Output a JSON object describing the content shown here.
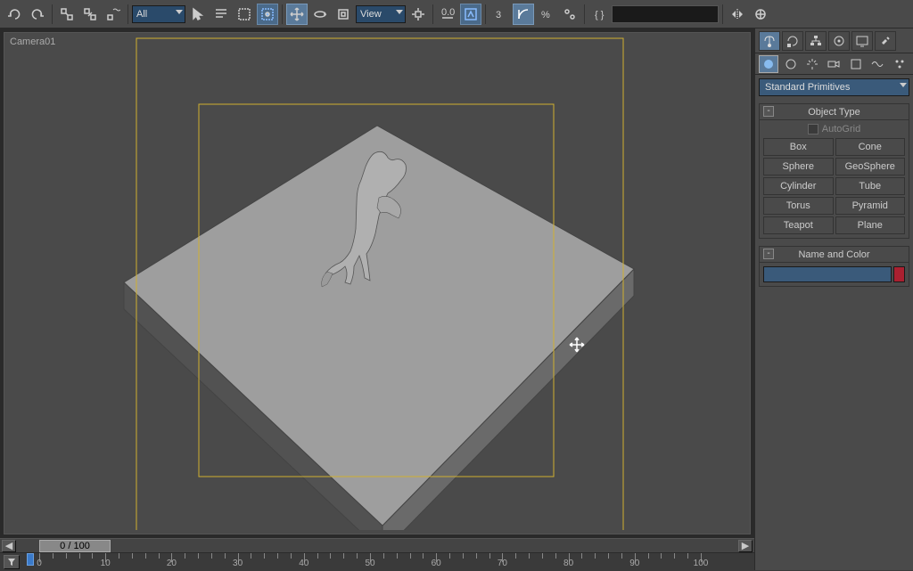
{
  "toolbar": {
    "filter_combo": "All",
    "view_combo": "View",
    "search_value": ""
  },
  "viewport": {
    "label": "Camera01"
  },
  "timeline": {
    "position": "0 / 100",
    "ticks": [
      0,
      10,
      20,
      30,
      40,
      50,
      60,
      70,
      80,
      90,
      100
    ]
  },
  "panel": {
    "category": "Standard Primitives",
    "rollouts": {
      "object_type": {
        "title": "Object Type",
        "autogrid_label": "AutoGrid",
        "buttons": [
          "Box",
          "Cone",
          "Sphere",
          "GeoSphere",
          "Cylinder",
          "Tube",
          "Torus",
          "Pyramid",
          "Teapot",
          "Plane"
        ]
      },
      "name_color": {
        "title": "Name and Color",
        "name_value": ""
      }
    }
  }
}
